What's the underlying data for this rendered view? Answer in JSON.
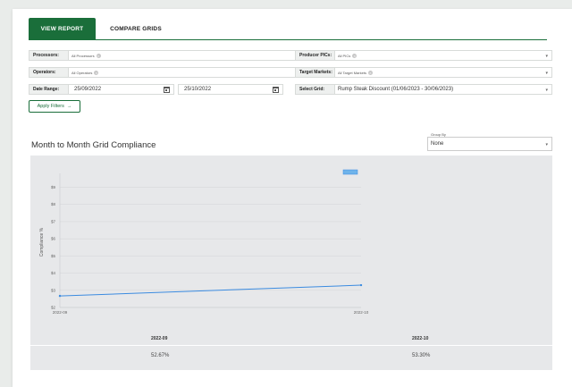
{
  "tabs": [
    {
      "label": "VIEW REPORT",
      "active": true
    },
    {
      "label": "COMPARE GRIDS",
      "active": false
    }
  ],
  "filters": {
    "processors": {
      "label": "Processors:",
      "chip": "All Processors"
    },
    "operators": {
      "label": "Operators:",
      "chip": "All Operators"
    },
    "date_range": {
      "label": "Date Range:",
      "start": "25/09/2022",
      "end": "25/10/2022"
    },
    "producer_pics": {
      "label": "Producer PICs:",
      "chip": "All PICs"
    },
    "target_markets": {
      "label": "Target Markets:",
      "chip": "All Target Markets"
    },
    "select_grid": {
      "label": "Select Grid:",
      "value": "Rump Steak Discount (01/06/2023 - 30/06/2023)"
    }
  },
  "apply_button": "Apply Filters",
  "chart_title": "Month to Month Grid Compliance",
  "group_by": {
    "label": "Group By",
    "value": "None"
  },
  "colors": {
    "brand_green": "#1a6e3a",
    "line_blue": "#3b8be0",
    "panel_bg": "#e7e8ea"
  },
  "chart_data": {
    "type": "line",
    "ylabel": "Compliance %",
    "yticks": [
      "$9",
      "$8",
      "$7",
      "$6",
      "$5",
      "$4",
      "$3",
      "$2"
    ],
    "ylim": [
      2,
      9.6
    ],
    "x": [
      "2022-09",
      "2022-10"
    ],
    "series": [
      {
        "values": [
          2.67,
          3.3
        ]
      }
    ],
    "legend_position": "top-right",
    "grid": true
  },
  "table": {
    "headers": [
      "2022-09",
      "2022-10"
    ],
    "values": [
      "52.67%",
      "53.30%"
    ]
  }
}
